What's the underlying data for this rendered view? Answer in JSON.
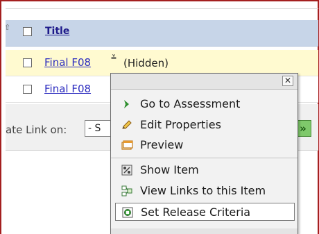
{
  "table": {
    "header_title": "Title",
    "rows": [
      {
        "title": "Final F08",
        "status": "(Hidden)"
      },
      {
        "title": "Final F08"
      }
    ]
  },
  "filter": {
    "label": "ate Link on:",
    "select_value": "- S"
  },
  "context_menu": {
    "close_glyph": "✕",
    "items": [
      {
        "label": "Go to Assessment",
        "icon": "go-arrow-icon"
      },
      {
        "label": "Edit Properties",
        "icon": "pencil-icon"
      },
      {
        "label": "Preview",
        "icon": "preview-window-icon"
      },
      {
        "label": "Show Item",
        "icon": "show-item-icon"
      },
      {
        "label": "View Links to this Item",
        "icon": "links-icon"
      },
      {
        "label": "Set Release Criteria",
        "icon": "release-criteria-icon"
      }
    ],
    "selected_index": 5
  },
  "colors": {
    "border_accent": "#a41f1f",
    "header_bg": "#c7d5e8",
    "highlight_row_bg": "#fffad0",
    "link": "#2b2bbf",
    "go_button": "#7fc96b"
  }
}
